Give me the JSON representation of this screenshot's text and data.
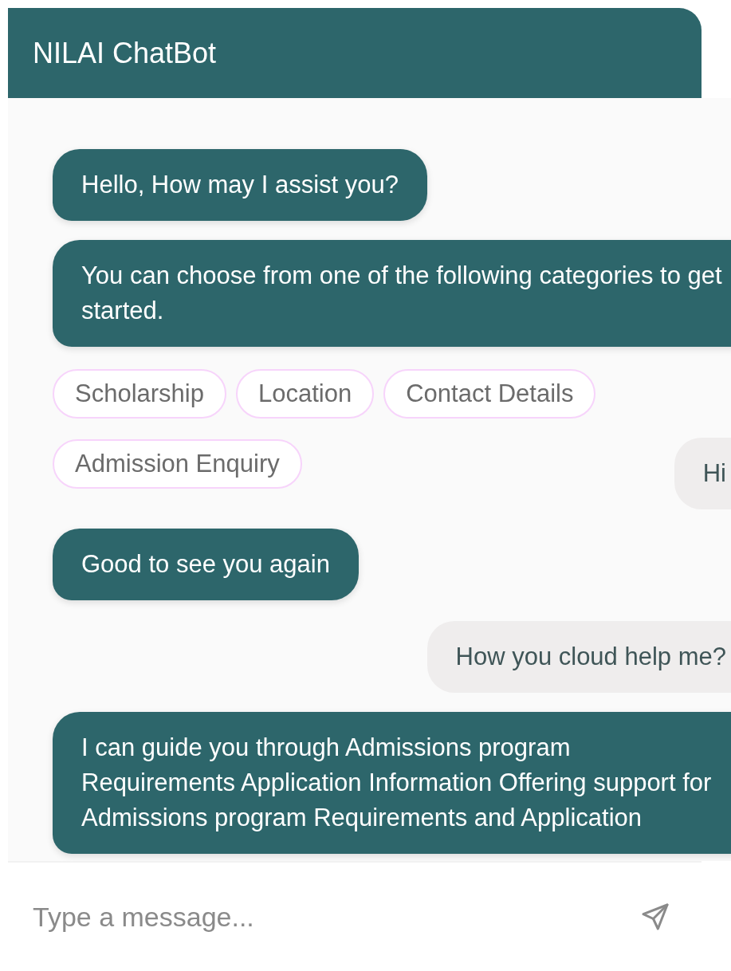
{
  "header": {
    "title": "NILAI ChatBot"
  },
  "messages": [
    {
      "kind": "bot",
      "text": "Hello, How may I assist you?"
    },
    {
      "kind": "bot",
      "text": "You can choose from one of the following categories to get started."
    },
    {
      "kind": "options",
      "options": [
        "Scholarship",
        "Location",
        "Contact Details",
        "Admission Enquiry"
      ]
    },
    {
      "kind": "user",
      "text": "Hi"
    },
    {
      "kind": "bot",
      "text": "Good to see you again"
    },
    {
      "kind": "user",
      "text": "How you cloud help me?"
    },
    {
      "kind": "bot",
      "text": "I can guide you through Admissions program Requirements Application Information Offering support for Admissions program Requirements and Application"
    }
  ],
  "composer": {
    "placeholder": "Type a message..."
  }
}
